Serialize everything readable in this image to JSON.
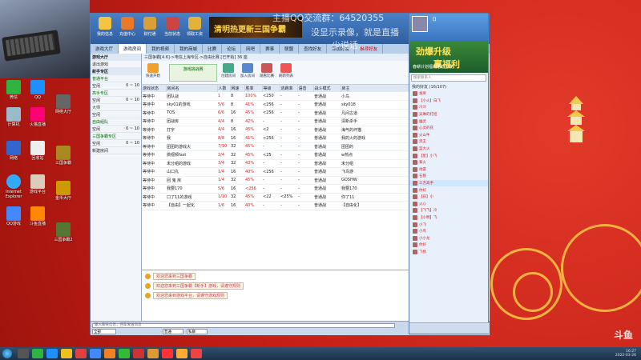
{
  "overlay": {
    "qq_group": "主播QQ交流群：64520355",
    "line2": "没显示录像，就是直播",
    "line3": "少说话..."
  },
  "desktop_icons": [
    {
      "label": "微信"
    },
    {
      "label": "QQ"
    },
    {
      "label": "计算机"
    },
    {
      "label": "火猫直播"
    },
    {
      "label": "网络"
    },
    {
      "label": "回收站"
    },
    {
      "label": "Internet Explorer"
    },
    {
      "label": "游戏平台"
    },
    {
      "label": "QQ游戏"
    },
    {
      "label": "斗鱼直播"
    },
    {
      "label": "网络大厅"
    },
    {
      "label": "三国争霸"
    },
    {
      "label": "金币大厅"
    },
    {
      "label": "三国争霸2"
    }
  ],
  "toolbar": {
    "items": [
      "我的信息",
      "充值中心",
      "财付通",
      "当前状态",
      "领取工资"
    ],
    "banner": "清明热更新三国争霸"
  },
  "tabs": [
    "游戏大厅",
    "游戏房间",
    "我的视频",
    "我的商城",
    "比赛",
    "论坛",
    "网吧",
    "赛事",
    "联盟",
    "查找好友",
    "添加好友",
    "推荐好友"
  ],
  "left_panel": {
    "items": [
      {
        "label": "游戏大厅",
        "value": ""
      },
      {
        "label": "退出游戏",
        "value": ""
      },
      {
        "label": "新手专区",
        "value": ""
      },
      {
        "label": "普通平台",
        "value": ""
      },
      {
        "label": "空闲",
        "value": "0 ~ 10"
      },
      {
        "label": "高手专区",
        "value": ""
      },
      {
        "label": "空闲",
        "value": "0 ~ 10"
      },
      {
        "label": "大师",
        "value": ""
      },
      {
        "label": "空闲",
        "value": ""
      },
      {
        "label": "自由组队",
        "value": ""
      },
      {
        "label": "空闲",
        "value": "0 ~ 10"
      },
      {
        "label": "三国争霸专区",
        "value": ""
      },
      {
        "label": "空闲",
        "value": "0 ~ 10"
      },
      {
        "label": "新建房间",
        "value": ""
      }
    ]
  },
  "room": {
    "crumbs": "三国争霸[4.6]->电信上海专区->自由比赛 [已开始] 36 座",
    "promo": "游戏挑战赛",
    "action_buttons": [
      "快速开始",
      "创建房间",
      "加入房间",
      "观看比赛",
      "刷新列表"
    ]
  },
  "table": {
    "headers": [
      "游戏状态",
      "房间名",
      "人数",
      "网速",
      "胜率",
      "等级",
      "逃跑率",
      "语音",
      "战斗模式",
      "房主"
    ],
    "rows": [
      [
        "等待中",
        "团队战",
        "1",
        "8",
        "100%",
        "<250",
        "-",
        "-",
        "普通战",
        "小鸟"
      ],
      [
        "等待中",
        "sky01的游戏",
        "5/6",
        "8",
        "41%",
        "<256",
        "-",
        "-",
        "普通战",
        "sky018"
      ],
      [
        "等待中",
        "TOS",
        "6/6",
        "16",
        "45%",
        "<256",
        "-",
        "-",
        "普通战",
        "凡间古道"
      ],
      [
        "等待中",
        "团战房",
        "4/4",
        "8",
        "42%",
        "-",
        "-",
        "-",
        "普通战",
        "清新杀手"
      ],
      [
        "等待中",
        "打字",
        "4/4",
        "16",
        "45%",
        "<2",
        "-",
        "-",
        "普通战",
        "海气的坏猫"
      ],
      [
        "等待中",
        "我",
        "8/8",
        "16",
        "41%",
        "<256",
        "-",
        "-",
        "普通战",
        "我的火的游戏"
      ],
      [
        "等待中",
        "团团的游戏大",
        "7/10",
        "32",
        "45%",
        "-",
        "-",
        "-",
        "普通战",
        "团团的"
      ],
      [
        "等待中",
        "搞视频fast",
        "2/4",
        "32",
        "45%",
        "<25",
        "-",
        "-",
        "普通战",
        "w热点"
      ],
      [
        "等待中",
        "未分组的游戏",
        "3/4",
        "32",
        "43%",
        "-",
        "-",
        "-",
        "普通战",
        "未分组"
      ],
      [
        "等待中",
        "山口丸",
        "1/4",
        "16",
        "40%",
        "<256",
        "-",
        "-",
        "普通战",
        "飞鸟游"
      ],
      [
        "等待中",
        "回 鬼 房",
        "1/4",
        "32",
        "45%",
        "-",
        "-",
        "-",
        "普通战",
        "GOSHW"
      ],
      [
        "等待中",
        "我要170",
        "5/6",
        "16",
        "<256",
        "-",
        "-",
        "-",
        "普通战",
        "我要170"
      ],
      [
        "等待中",
        "口了11的游戏",
        "1/10",
        "32",
        "45%",
        "<22",
        "<25%",
        "-",
        "普通战",
        "你了11"
      ],
      [
        "等待中",
        "【自由】一起化",
        "1/6",
        "16",
        "40%",
        "-",
        "-",
        "-",
        "普通战",
        "【自由化】"
      ]
    ]
  },
  "chat": {
    "messages": [
      "欢迎您来到三国争霸",
      "欢迎您来到三国争霸【新手】游戏，请遵守规则",
      "欢迎您来到游戏平台，请遵守游戏规则"
    ]
  },
  "bottom": {
    "input_placeholder": "输入聊天信息，回车发送消息",
    "selects": [
      "全部",
      "普通",
      "私聊"
    ],
    "send": "发送"
  },
  "qq": {
    "name": "【】",
    "ad_title": "劲爆升级",
    "ad_title2": "赢福利",
    "ad_sub": "春耕计划福利活动上线",
    "search_placeholder": "搜索联系人",
    "group_label": "我的好友 (16/107)",
    "contacts": [
      "发呆",
      "【小火】白飞",
      "冷冷",
      "吴琳的打招",
      "幽灵",
      "心灵的花",
      "火山牛",
      "黑王",
      "蓝大火",
      "【星】小飞",
      "紫火",
      "地雷",
      "石狼",
      "三方高手",
      "你好",
      "【孩】小",
      "火心",
      "【飞飞】冷",
      "【小明】飞",
      "小飞",
      "小鸟",
      "小小龙",
      "你好",
      "飞扬"
    ],
    "selected_index": 13
  },
  "taskbar": {
    "time": "16:27",
    "date": "2022-03-26"
  },
  "watermark": "斗鱼",
  "colors": {
    "accent": "#3a76c0",
    "warn": "#d22222",
    "wallpaper": "#c41e16"
  }
}
